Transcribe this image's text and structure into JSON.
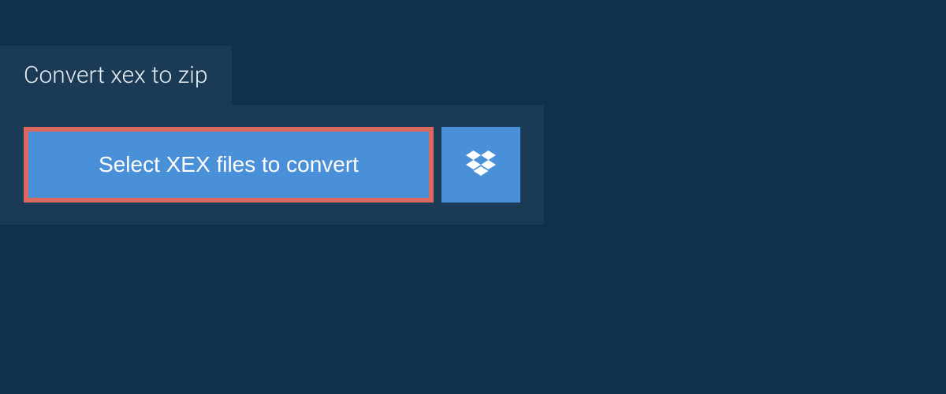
{
  "tab": {
    "label": "Convert xex to zip"
  },
  "actions": {
    "select_files_label": "Select XEX files to convert"
  },
  "colors": {
    "background": "#10304c",
    "panel": "#1a3a56",
    "button": "#4a90d9",
    "highlight_border": "#dc6960",
    "text_light": "#e8edf2"
  }
}
